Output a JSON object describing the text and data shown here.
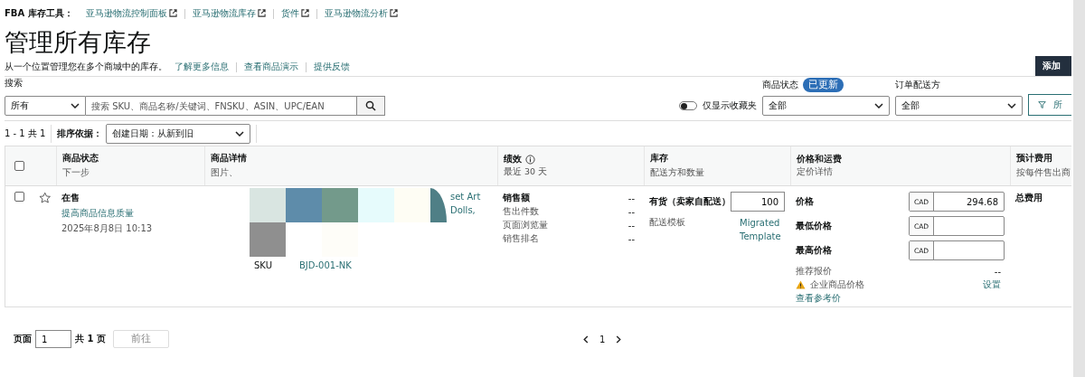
{
  "tools": {
    "label": "FBA 库存工具：",
    "links": [
      "亚马逊物流控制面板",
      "亚马逊物流库存",
      "货件",
      "亚马逊物流分析"
    ]
  },
  "title": "管理所有库存",
  "subtitle": {
    "text": "从一个位置管理您在多个商城中的库存。",
    "links": [
      "了解更多信息",
      "查看商品演示",
      "提供反馈"
    ]
  },
  "add_button": "添加",
  "search": {
    "label": "搜索",
    "scope": "所有",
    "placeholder": "搜索 SKU、商品名称/关键词、FNSKU、ASIN、UPC/EAN"
  },
  "favorites_toggle": {
    "label": "仅显示收藏夹",
    "on": false
  },
  "status_filter": {
    "label": "商品状态",
    "badge": "已更新",
    "value": "全部"
  },
  "fulfillment_filter": {
    "label": "订单配送方",
    "value": "全部"
  },
  "filter_button": "所",
  "count": "1 - 1 共 1",
  "sort": {
    "label": "排序依据：",
    "value": "创建日期：从新到旧"
  },
  "select_all_checked": false,
  "columns": [
    {
      "title": "商品状态",
      "sub": "下一步"
    },
    {
      "title": "商品详情",
      "sub": "图片、"
    },
    {
      "title": "绩效",
      "sub": "最近 30 天",
      "info": true
    },
    {
      "title": "库存",
      "sub": "配送方和数量"
    },
    {
      "title": "价格和运费",
      "sub": "定价详情"
    },
    {
      "title": "预计费用",
      "sub": "按每件售出商"
    }
  ],
  "row": {
    "checked": false,
    "starred": false,
    "status": "在售",
    "action": "提高商品信息质量",
    "date": "2025年8月8日 10:13",
    "title_fragments": [
      "set Art",
      "Dolls,"
    ],
    "sku_label": "SKU",
    "sku": "BJD-001-NK",
    "metrics": [
      {
        "label": "销售额",
        "value": "--",
        "bold": true
      },
      {
        "label": "售出件数",
        "value": "--",
        "bold": false
      },
      {
        "label": "页面浏览量",
        "value": "--",
        "bold": false
      },
      {
        "label": "销售排名",
        "value": "--",
        "bold": false
      }
    ],
    "stock_label": "有货（卖家自配送）",
    "quantity": "100",
    "template_label": "配送模板",
    "template": "Migrated Template",
    "prices": [
      {
        "label": "价格",
        "currency": "CAD",
        "value": "294.68"
      },
      {
        "label": "最低价格",
        "currency": "CAD"
      },
      {
        "label": "最高价格",
        "currency": "CAD"
      }
    ],
    "suggested": {
      "label": "推荐报价",
      "value": "--"
    },
    "business_price": {
      "label": "企业商品价格",
      "link": "设置"
    },
    "reference_link": "查看参考价",
    "fees": "总费用"
  },
  "pagination": {
    "label": "页面",
    "page": "1",
    "total": "共 1 页",
    "go": "前往",
    "current": "1"
  }
}
